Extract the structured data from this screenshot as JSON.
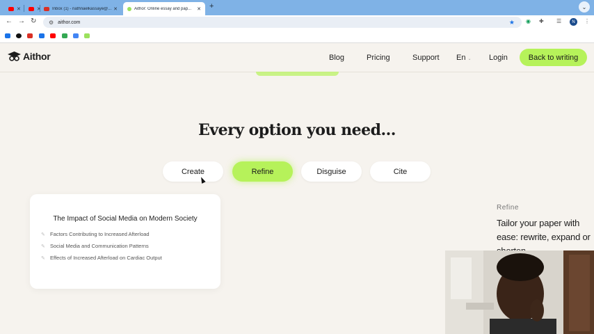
{
  "browser": {
    "tabs": [
      {
        "title": "",
        "favicon_color": "#ff0000"
      },
      {
        "title": "",
        "favicon_color": "#ff0000"
      },
      {
        "title": "Inbox (1) - nathnaelkassaye@...",
        "favicon_color": "#d93025"
      },
      {
        "title": "Aithor: Online essay and pap...",
        "favicon_color": "#9be15d",
        "active": true
      }
    ],
    "url": "aithor.com",
    "profile_initial": "N"
  },
  "site": {
    "logo": "Aithor",
    "nav": [
      "Blog",
      "Pricing",
      "Support",
      "En",
      "Login"
    ],
    "cta_label": "Back to writing"
  },
  "main": {
    "headline": "Every option you need...",
    "options": [
      {
        "label": "Create",
        "active": false
      },
      {
        "label": "Refine",
        "active": true
      },
      {
        "label": "Disguise",
        "active": false
      },
      {
        "label": "Cite",
        "active": false
      }
    ],
    "card": {
      "title": "The Impact of Social Media on Modern Society",
      "items": [
        "Factors Contributing to Increased Afterload",
        "Social Media and Communication Patterns",
        "Effects of Increased Afterload on Cardiac Output"
      ]
    },
    "side": {
      "label": "Refine",
      "description": "Tailor your paper with ease: rewrite, expand or shorten"
    }
  },
  "colors": {
    "accent_green": "#b6f25a",
    "page_background": "#f6f3ee",
    "tabbar": "#7fb2e6"
  }
}
